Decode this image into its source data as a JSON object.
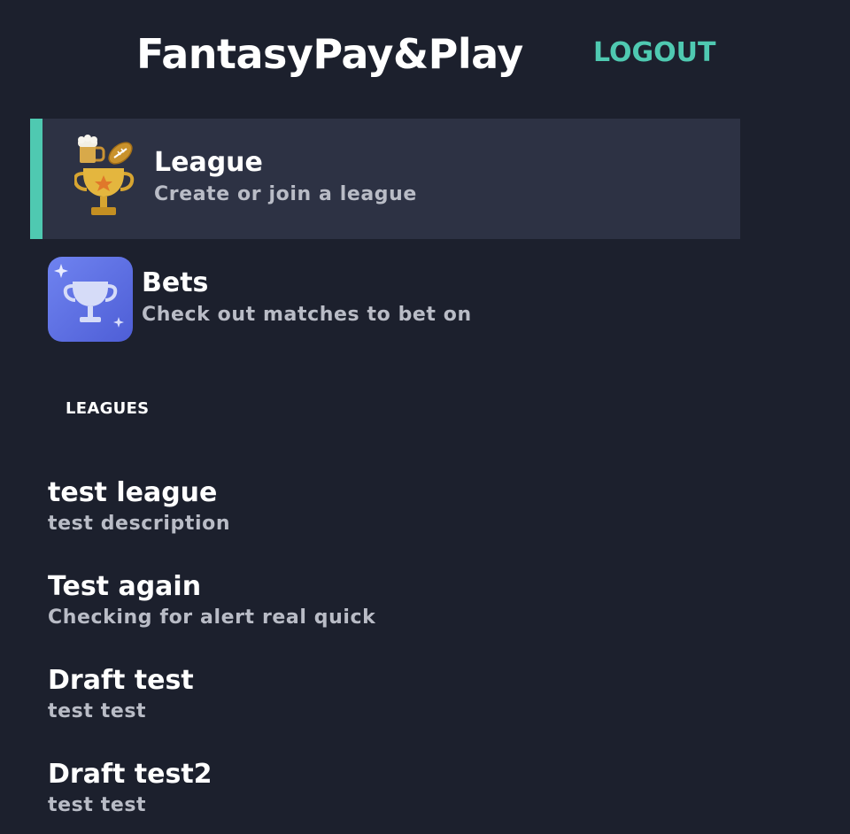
{
  "header": {
    "app_title": "FantasyPay&Play",
    "logout_label": "LOGOUT"
  },
  "nav": {
    "items": [
      {
        "title": "League",
        "subtitle": "Create or join a league",
        "icon": "trophy-football-icon",
        "active": true
      },
      {
        "title": "Bets",
        "subtitle": "Check out matches to bet on",
        "icon": "trophy-icon",
        "active": false
      }
    ]
  },
  "leagues": {
    "heading": "LEAGUES",
    "items": [
      {
        "name": "test league",
        "description": "test description"
      },
      {
        "name": "Test again",
        "description": "Checking for alert real quick"
      },
      {
        "name": "Draft test",
        "description": "test test"
      },
      {
        "name": "Draft test2",
        "description": "test test"
      }
    ]
  },
  "colors": {
    "background": "#1c202d",
    "active_item_bg": "#2d3244",
    "accent": "#4fc9b1",
    "subtext": "#b9bcc6"
  }
}
